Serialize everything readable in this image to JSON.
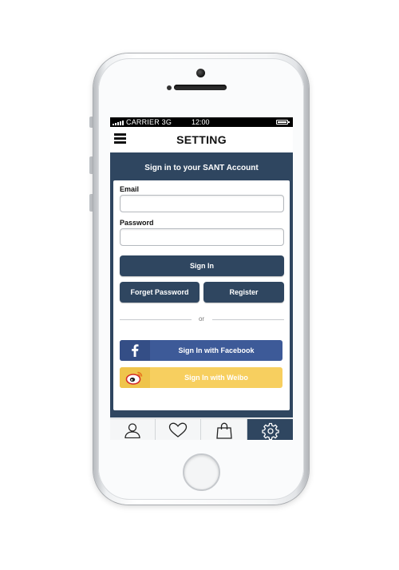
{
  "status_bar": {
    "carrier": "CARRIER",
    "network": "3G",
    "time": "12:00",
    "battery_level": 1.0
  },
  "nav": {
    "title": "SETTING",
    "menu_icon": "hamburger-menu-icon"
  },
  "signin": {
    "header": "Sign in to your SANT Account",
    "email_label": "Email",
    "email_value": "",
    "password_label": "Password",
    "password_value": "",
    "signin_button": "Sign In",
    "forget_password_button": "Forget Password",
    "register_button": "Register",
    "or_text": "or",
    "facebook_button": "Sign In with Facebook",
    "weibo_button": "Sign In with Weibo"
  },
  "tabs": [
    {
      "name": "profile",
      "icon": "user-icon",
      "active": false
    },
    {
      "name": "favorites",
      "icon": "heart-icon",
      "active": false
    },
    {
      "name": "cart",
      "icon": "shopping-bag-icon",
      "active": false
    },
    {
      "name": "settings",
      "icon": "gear-icon",
      "active": true
    }
  ],
  "colors": {
    "primary": "#2f4660",
    "facebook": "#3d5a98",
    "weibo": "#f7cf5f"
  }
}
